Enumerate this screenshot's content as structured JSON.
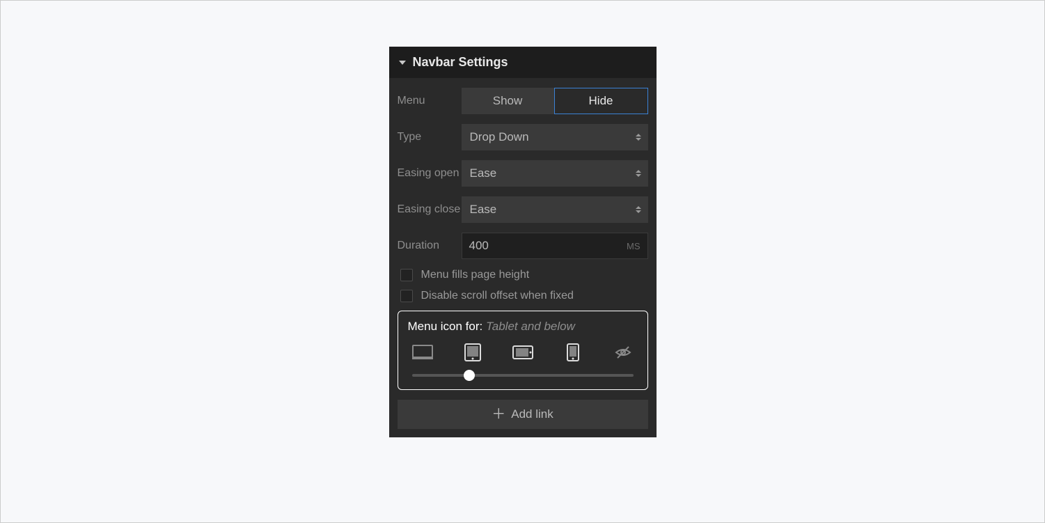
{
  "header": {
    "title": "Navbar Settings"
  },
  "menu": {
    "label": "Menu",
    "options": {
      "show": "Show",
      "hide": "Hide"
    },
    "active": "hide"
  },
  "type": {
    "label": "Type",
    "value": "Drop Down"
  },
  "easing_open": {
    "label": "Easing open",
    "value": "Ease"
  },
  "easing_close": {
    "label": "Easing close",
    "value": "Ease"
  },
  "duration": {
    "label": "Duration",
    "value": "400",
    "unit": "MS"
  },
  "checkboxes": {
    "fills": "Menu fills page height",
    "disable_scroll": "Disable scroll offset when fixed"
  },
  "breakpoint": {
    "prefix": "Menu icon for: ",
    "value": "Tablet and below",
    "slider_percent": 26
  },
  "add_link": {
    "label": "Add link"
  }
}
